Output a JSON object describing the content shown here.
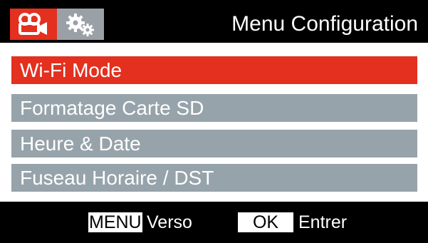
{
  "header": {
    "title": "Menu Configuration",
    "tabs": [
      {
        "icon": "video-camera-icon",
        "active": true
      },
      {
        "icon": "gears-icon",
        "active": false
      }
    ]
  },
  "menu": {
    "items": [
      {
        "label": "Wi-Fi Mode",
        "selected": true
      },
      {
        "label": "Formatage Carte SD",
        "selected": false
      },
      {
        "label": "Heure & Date",
        "selected": false
      },
      {
        "label": "Fuseau Horaire / DST",
        "selected": false
      }
    ]
  },
  "footer": {
    "menu_key": "MENU",
    "menu_action": "Verso",
    "ok_key": "OK",
    "ok_action": "Entrer"
  },
  "colors": {
    "accent": "#e3301f",
    "item_bg": "#97a3aa",
    "background": "#000000"
  }
}
